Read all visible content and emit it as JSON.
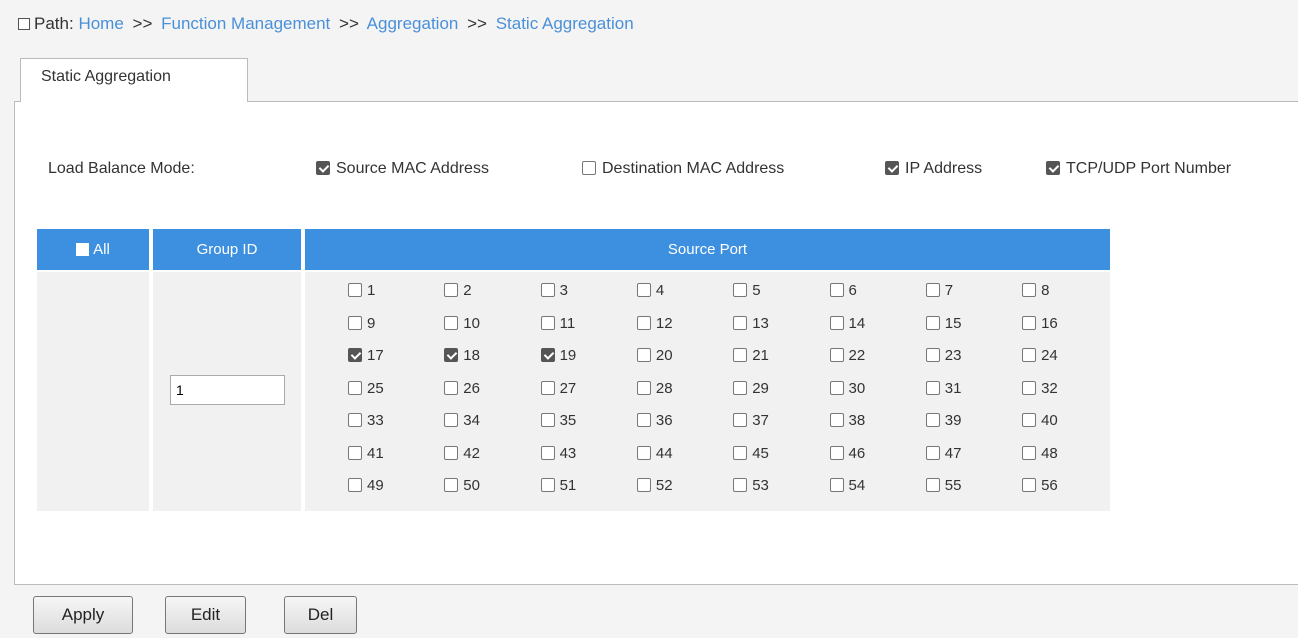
{
  "path": {
    "label": "Path:",
    "crumbs": [
      "Home",
      "Function Management",
      "Aggregation",
      "Static Aggregation"
    ],
    "separator": ">>"
  },
  "tab": {
    "label": "Static Aggregation"
  },
  "load_balance": {
    "label": "Load Balance Mode:",
    "options": [
      {
        "label": "Source MAC Address",
        "checked": true
      },
      {
        "label": "Destination MAC Address",
        "checked": false
      },
      {
        "label": "IP Address",
        "checked": true
      },
      {
        "label": "TCP/UDP Port Number",
        "checked": true
      }
    ]
  },
  "table": {
    "all_label": "All",
    "group_id_header": "Group ID",
    "source_port_header": "Source Port",
    "group_id_value": "1",
    "ports_checked": [
      17,
      18,
      19
    ],
    "port_count": 56
  },
  "buttons": {
    "apply": "Apply",
    "edit": "Edit",
    "del": "Del"
  },
  "colors": {
    "header_bg": "#3d8fe0",
    "link": "#4a90d9"
  }
}
